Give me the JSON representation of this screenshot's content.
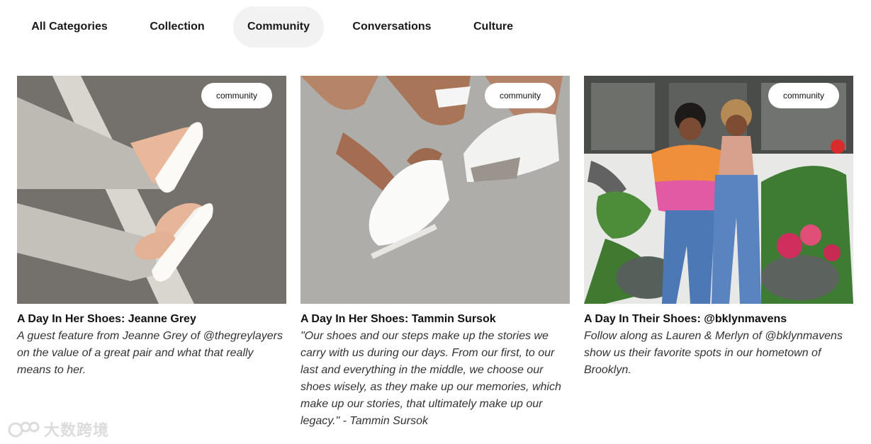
{
  "tabs": [
    {
      "label": "All Categories",
      "active": false
    },
    {
      "label": "Collection",
      "active": false
    },
    {
      "label": "Community",
      "active": true
    },
    {
      "label": "Conversations",
      "active": false
    },
    {
      "label": "Culture",
      "active": false
    }
  ],
  "cards": [
    {
      "badge": "community",
      "title": "A Day In Her Shoes: Jeanne Grey",
      "description": "A guest feature from Jeanne Grey of @thegreylayers on the value of a great pair and what that really means to her.",
      "image_icon": "sneakers-on-street-photo"
    },
    {
      "badge": "community",
      "title": "A Day In Her Shoes: Tammin Sursok",
      "description": "\"Our shoes and our steps make up the stories we carry with us during our days. From our first, to our last and everything in the middle, we choose our shoes wisely, as they make up our memories, which make up our stories, that ultimately make up our legacy.\" - Tammin Sursok",
      "image_icon": "tying-sneaker-photo"
    },
    {
      "badge": "community",
      "title": "A Day In Their Shoes: @bklynmavens",
      "description": "Follow along as Lauren & Merlyn of @bklynmavens show us their favorite spots in our hometown of Brooklyn.",
      "image_icon": "two-women-storefront-photo"
    }
  ],
  "watermark": "大数跨境",
  "colors": {
    "active_tab_bg": "#f2f2f2",
    "badge_bg": "#ffffff"
  }
}
